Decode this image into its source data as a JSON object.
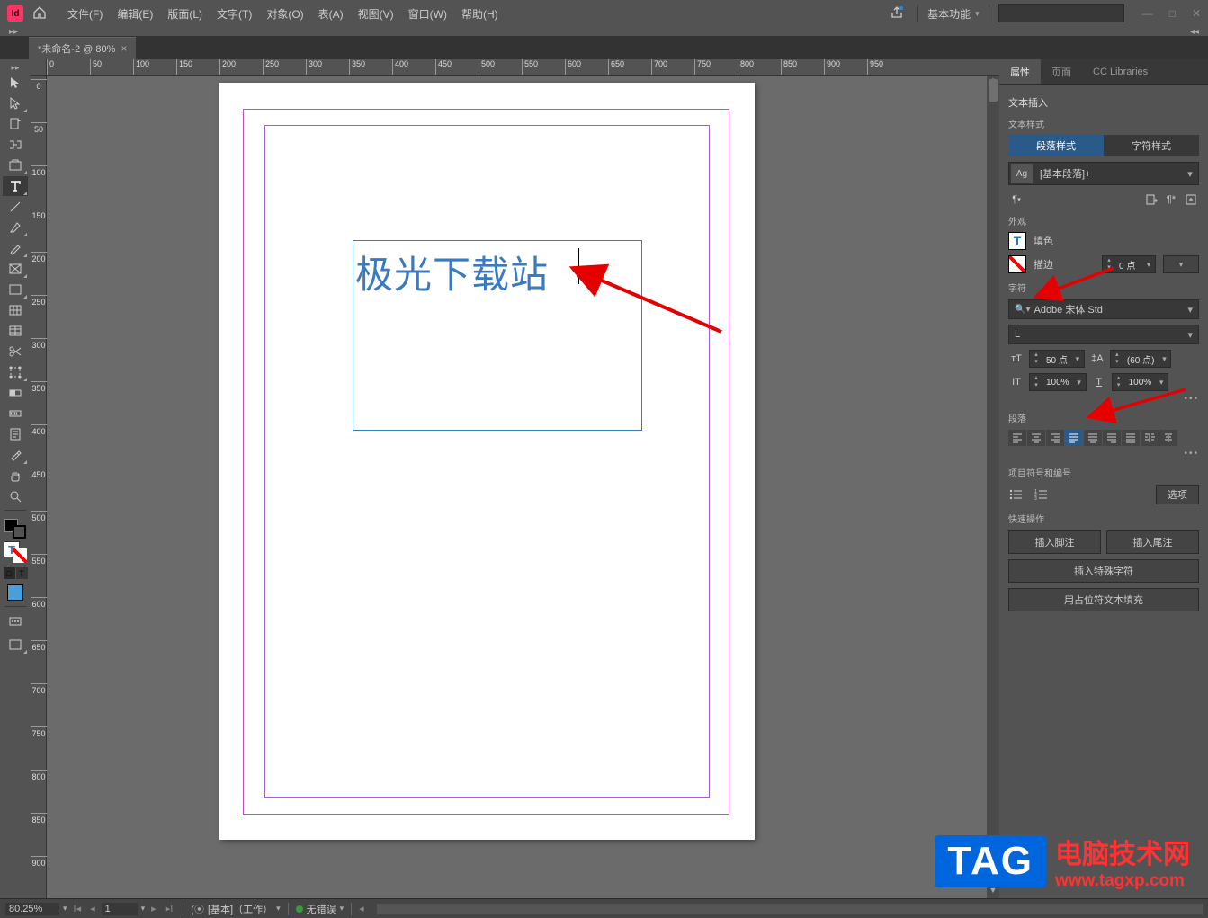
{
  "menubar": {
    "items": [
      "文件(F)",
      "编辑(E)",
      "版面(L)",
      "文字(T)",
      "对象(O)",
      "表(A)",
      "视图(V)",
      "窗口(W)",
      "帮助(H)"
    ],
    "workspace": "基本功能"
  },
  "tab": {
    "title": "*未命名-2 @ 80%"
  },
  "ruler_h": [
    "0",
    "50",
    "100",
    "150",
    "200",
    "250",
    "300",
    "350",
    "400",
    "450",
    "500",
    "550",
    "600",
    "650",
    "700",
    "750",
    "800",
    "850",
    "900",
    "950"
  ],
  "ruler_v": [
    "0",
    "50",
    "100",
    "150",
    "200",
    "250",
    "300",
    "350",
    "400",
    "450",
    "500",
    "550",
    "600",
    "650",
    "700",
    "750",
    "800",
    "850",
    "900"
  ],
  "canvas": {
    "text": "极光下载站"
  },
  "panel": {
    "tabs": [
      "属性",
      "页面",
      "CC Libraries"
    ],
    "context": "文本插入",
    "text_style_label": "文本样式",
    "style_tabs": [
      "段落样式",
      "字符样式"
    ],
    "style_name": "[基本段落]+",
    "appearance": {
      "label": "外观",
      "fill": "填色",
      "stroke": "描边",
      "stroke_weight": "0 点"
    },
    "character": {
      "label": "字符",
      "font": "Adobe 宋体 Std",
      "weight": "L",
      "size": "50 点",
      "leading": "(60 点)",
      "hscale": "100%",
      "vscale": "100%"
    },
    "paragraph": {
      "label": "段落"
    },
    "bullets": {
      "label": "项目符号和编号",
      "options": "选项"
    },
    "quick": {
      "label": "快速操作",
      "btns": [
        "插入脚注",
        "插入尾注",
        "插入特殊字符",
        "用占位符文本填充"
      ]
    }
  },
  "statusbar": {
    "zoom": "80.25%",
    "page": "1",
    "profile": "[基本]（工作）",
    "errors": "无错误"
  },
  "watermark": {
    "tag": "TAG",
    "cn": "电脑技术网",
    "url": "www.tagxp.com"
  }
}
